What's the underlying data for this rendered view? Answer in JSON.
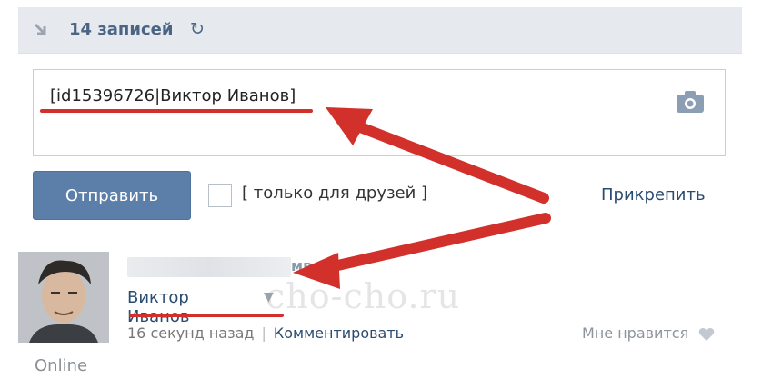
{
  "header": {
    "count_label": "14 записей",
    "refresh_glyph": "↻"
  },
  "composer": {
    "text": "[id15396726|Виктор Иванов]",
    "camera_icon": "camera-icon"
  },
  "actions": {
    "send_label": "Отправить",
    "friends_only_label": "[ только для друзей ]",
    "attach_label": "Прикрепить"
  },
  "post": {
    "author_visible_fragment": "мв",
    "mention_name": "Виктор Иванов",
    "dropdown_glyph": "▼",
    "time": "16 секунд назад",
    "separator": "|",
    "comment_label": "Комментировать",
    "like_label": "Мне нравится",
    "online_label": "Online"
  },
  "watermark": "cho-cho.ru",
  "colors": {
    "accent_red": "#d2302a",
    "button_blue": "#5b7fa8",
    "link_blue": "#2b4c6f",
    "header_bg": "#e6e9ed"
  }
}
